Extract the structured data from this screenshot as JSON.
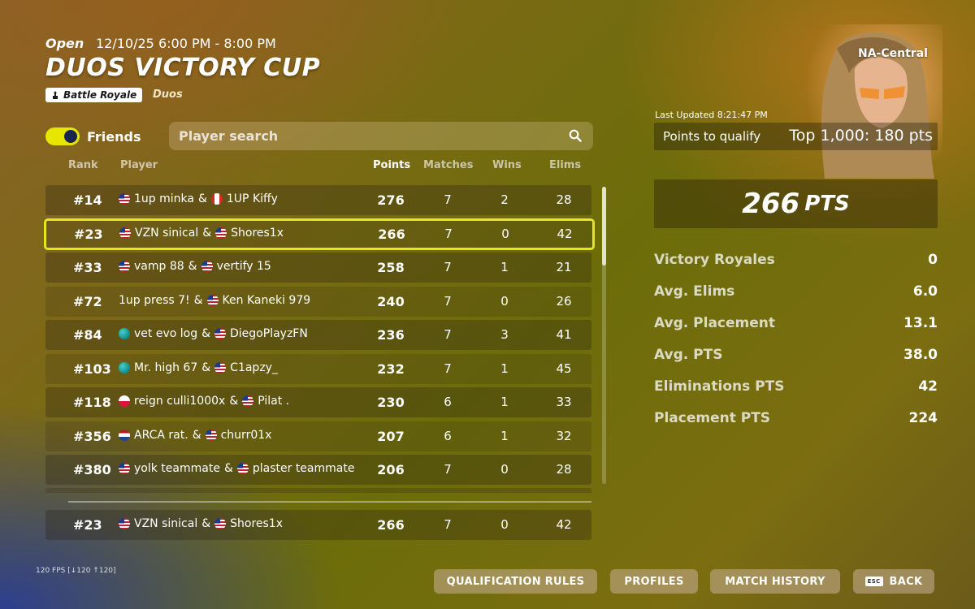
{
  "event": {
    "status": "Open",
    "datetime": "12/10/25 6:00 PM - 8:00 PM",
    "title": "DUOS VICTORY CUP",
    "mode": "Battle Royale",
    "submode": "Duos"
  },
  "filters": {
    "friends_label": "Friends",
    "friends_toggle_on": true,
    "search_placeholder": "Player search"
  },
  "columns": {
    "rank": "Rank",
    "player": "Player",
    "points": "Points",
    "matches": "Matches",
    "wins": "Wins",
    "elims": "Elims"
  },
  "leaderboard": [
    {
      "rank": "#14",
      "p1_flag": "us",
      "p1": "1up minka",
      "p2_flag": "ca",
      "p2": "1UP Kiffy",
      "points": "276",
      "matches": "7",
      "wins": "2",
      "elims": "28"
    },
    {
      "rank": "#23",
      "p1_flag": "us",
      "p1": "VZN sinical",
      "p2_flag": "us",
      "p2": "Shores1x",
      "points": "266",
      "matches": "7",
      "wins": "0",
      "elims": "42",
      "highlight": true
    },
    {
      "rank": "#33",
      "p1_flag": "us",
      "p1": "vamp 88",
      "p2_flag": "us",
      "p2": "vertify 15",
      "points": "258",
      "matches": "7",
      "wins": "1",
      "elims": "21"
    },
    {
      "rank": "#72",
      "p1_flag": "",
      "p1": "1up press 7!",
      "p2_flag": "us",
      "p2": "Ken Kaneki 979",
      "points": "240",
      "matches": "7",
      "wins": "0",
      "elims": "26"
    },
    {
      "rank": "#84",
      "p1_flag": "globe",
      "p1": "vet evo log",
      "p2_flag": "us",
      "p2": "DiegoPlayzFN",
      "points": "236",
      "matches": "7",
      "wins": "3",
      "elims": "41"
    },
    {
      "rank": "#103",
      "p1_flag": "globe",
      "p1": "Mr. high 67",
      "p2_flag": "us",
      "p2": "C1apzy_",
      "points": "232",
      "matches": "7",
      "wins": "1",
      "elims": "45"
    },
    {
      "rank": "#118",
      "p1_flag": "pl",
      "p1": "reign culli1000x",
      "p2_flag": "us",
      "p2": "Pilat .",
      "points": "230",
      "matches": "6",
      "wins": "1",
      "elims": "33"
    },
    {
      "rank": "#356",
      "p1_flag": "nl",
      "p1": "ARCA rat.",
      "p2_flag": "us",
      "p2": "churr01x",
      "points": "207",
      "matches": "6",
      "wins": "1",
      "elims": "32"
    },
    {
      "rank": "#380",
      "p1_flag": "us",
      "p1": "yolk teammate",
      "p2_flag": "us",
      "p2": "plaster teammate",
      "points": "206",
      "matches": "7",
      "wins": "0",
      "elims": "28"
    }
  ],
  "my_row": {
    "rank": "#23",
    "p1_flag": "us",
    "p1": "VZN sinical",
    "p2_flag": "us",
    "p2": "Shores1x",
    "points": "266",
    "matches": "7",
    "wins": "0",
    "elims": "42"
  },
  "scroll_position": 0,
  "region": "NA-Central",
  "last_updated": "Last Updated 8:21:47 PM",
  "qualify": {
    "label": "Points to qualify",
    "value": "Top 1,000: 180 pts"
  },
  "summary": {
    "points": "266",
    "unit": "PTS"
  },
  "stats": [
    {
      "label": "Victory Royales",
      "value": "0"
    },
    {
      "label": "Avg. Elims",
      "value": "6.0"
    },
    {
      "label": "Avg. Placement",
      "value": "13.1"
    },
    {
      "label": "Avg. PTS",
      "value": "38.0"
    },
    {
      "label": "Eliminations PTS",
      "value": "42"
    },
    {
      "label": "Placement PTS",
      "value": "224"
    }
  ],
  "fps": "120 FPS [↓120 ↑120]",
  "buttons": {
    "qualification_rules": "QUALIFICATION RULES",
    "profiles": "PROFILES",
    "match_history": "MATCH HISTORY",
    "esc_key": "ESC",
    "back": "BACK"
  },
  "colors": {
    "accent": "#e4e71c",
    "toggle_knob": "#1a2450"
  }
}
